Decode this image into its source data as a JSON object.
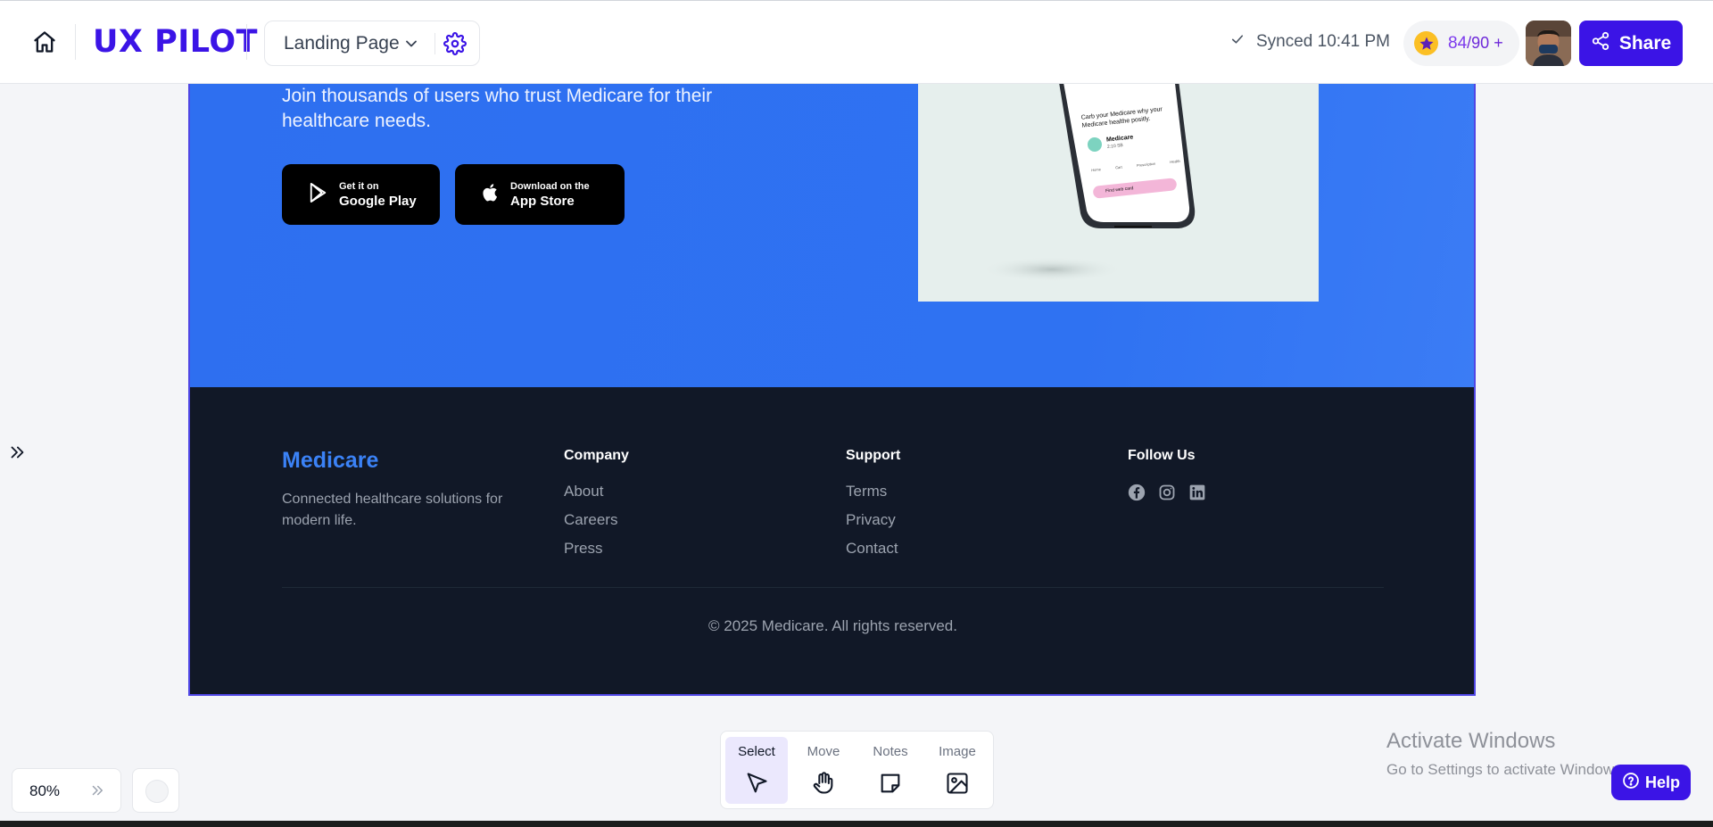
{
  "topbar": {
    "logo": "UX PILOT",
    "page_selector": "Landing Page",
    "synced": "Synced 10:41 PM",
    "credits_used": "84",
    "credits_total": "/90",
    "credits_plus": "+",
    "share_label": "Share"
  },
  "hero": {
    "tagline": "Join thousands of users who trust Medicare for their healthcare needs.",
    "google_play": {
      "small": "Get it on",
      "big": "Google Play"
    },
    "app_store": {
      "small": "Download on the",
      "big": "App Store"
    },
    "phone_screen": {
      "text": "Carb your Medicare why your Medicare healthe positly.",
      "profile_name": "Medicare",
      "profile_sub": "2:10 SB",
      "nav": [
        "Home",
        "Cart",
        "Prescription",
        "Health"
      ],
      "pill": "Find web card"
    }
  },
  "footer": {
    "brand": "Medicare",
    "description": "Connected healthcare solutions for modern life.",
    "company": {
      "heading": "Company",
      "links": [
        "About",
        "Careers",
        "Press"
      ]
    },
    "support": {
      "heading": "Support",
      "links": [
        "Terms",
        "Privacy",
        "Contact"
      ]
    },
    "follow": {
      "heading": "Follow Us",
      "icons": [
        "facebook-icon",
        "instagram-icon",
        "linkedin-icon"
      ]
    },
    "copyright": "© 2025 Medicare. All rights reserved."
  },
  "toolbar": {
    "select": "Select",
    "move": "Move",
    "notes": "Notes",
    "image": "Image"
  },
  "zoom": "80%",
  "watermark": {
    "title": "Activate Windows",
    "subtitle": "Go to Settings to activate Windows."
  },
  "help_label": "Help",
  "colors": {
    "brand": "#3b14e6",
    "hero_blue": "#2f72f2",
    "footer_bg": "#111827",
    "accent_blue": "#3b82f6"
  }
}
